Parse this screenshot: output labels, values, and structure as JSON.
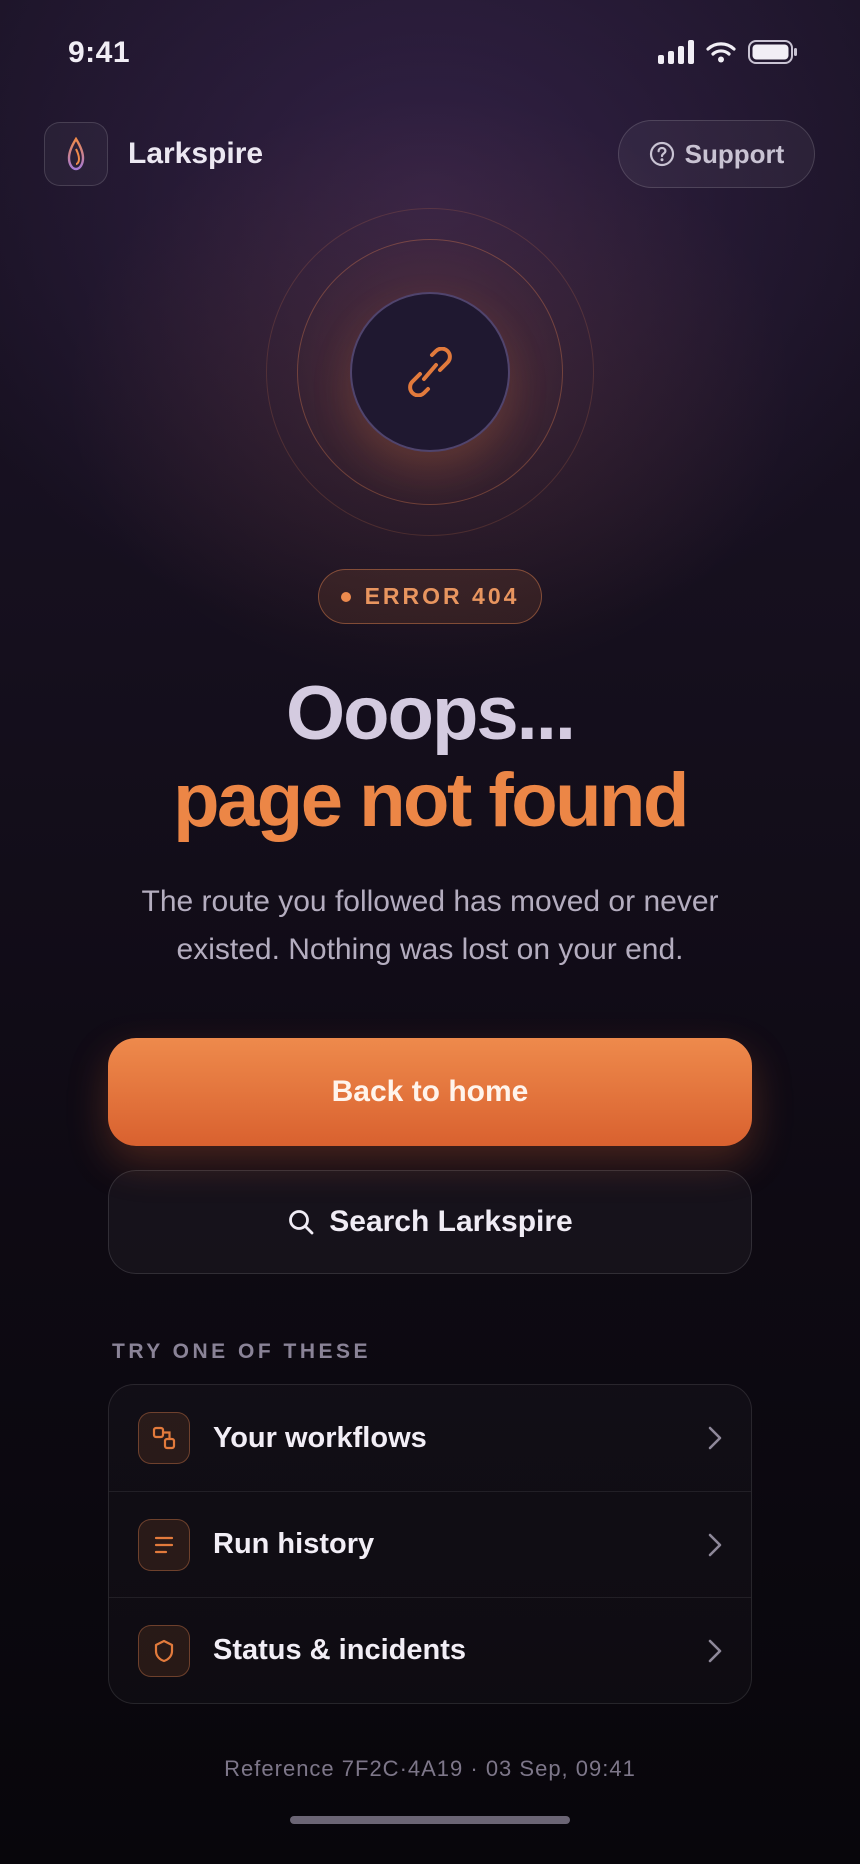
{
  "status_bar": {
    "time": "9:41"
  },
  "header": {
    "brand": "Larkspire",
    "support_label": "Support"
  },
  "error": {
    "badge": "ERROR 404",
    "headline_1": "Ooops...",
    "headline_2": "page not found",
    "description": "The route you followed has moved or never existed. Nothing was lost on your end."
  },
  "actions": {
    "primary_label": "Back to home",
    "search_label": "Search Larkspire"
  },
  "suggestions": {
    "heading": "TRY ONE OF THESE",
    "items": [
      {
        "label": "Your workflows",
        "icon": "workflow-icon"
      },
      {
        "label": "Run history",
        "icon": "list-icon"
      },
      {
        "label": "Status & incidents",
        "icon": "shield-icon"
      }
    ]
  },
  "footer": {
    "reference": "Reference 7F2C·4A19  ·  03 Sep, 09:41"
  },
  "colors": {
    "accent": "#ec8646",
    "background": "#150f1d",
    "headline": "#d4cbe0"
  }
}
